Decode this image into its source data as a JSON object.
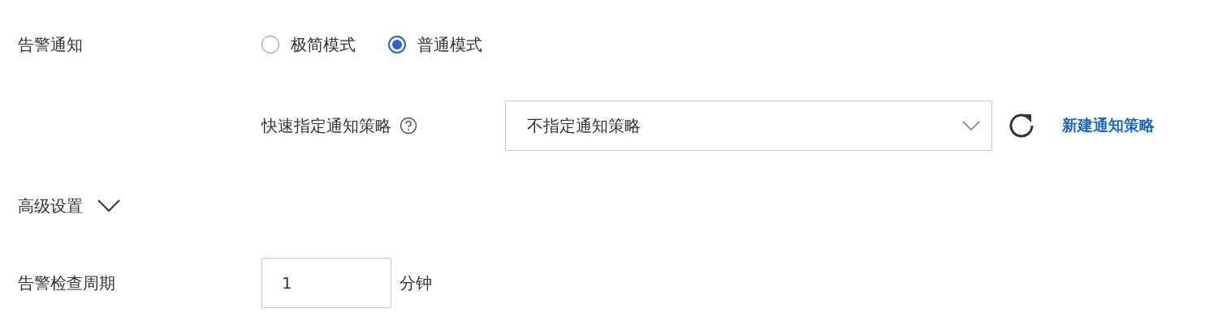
{
  "alert_notification": {
    "label": "告警通知",
    "modes": [
      {
        "label": "极简模式",
        "selected": false
      },
      {
        "label": "普通模式",
        "selected": true
      }
    ],
    "policy": {
      "label": "快速指定通知策略",
      "select_value": "不指定通知策略",
      "link": "新建通知策略"
    }
  },
  "advanced": {
    "label": "高级设置"
  },
  "check_period": {
    "label": "告警检查周期",
    "value": "1",
    "unit": "分钟"
  }
}
